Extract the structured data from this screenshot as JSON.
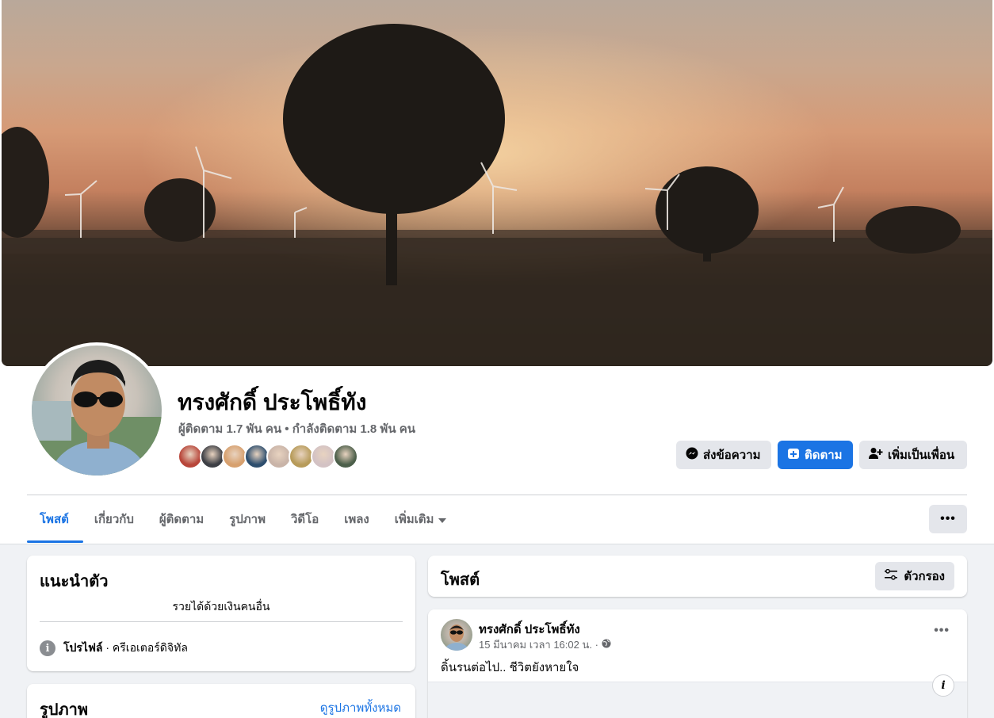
{
  "profile": {
    "name": "ทรงศักดิ์ ประโพธิ์ทัง",
    "follow_stats": "ผู้ติดตาม 1.7 พัน คน • กำลังติดตาม 1.8 พัน คน",
    "mutual_avatar_colors": [
      "#b8463a",
      "#3d3f45",
      "#d7a06e",
      "#2d4e6e",
      "#c9b4a8",
      "#b79b5a",
      "#d3c2c4",
      "#4c5f4a"
    ]
  },
  "actions": {
    "message": "ส่งข้อความ",
    "follow": "ติดตาม",
    "add_friend": "เพิ่มเป็นเพื่อน"
  },
  "tabs": [
    {
      "label": "โพสต์"
    },
    {
      "label": "เกี่ยวกับ"
    },
    {
      "label": "ผู้ติดตาม"
    },
    {
      "label": "รูปภาพ"
    },
    {
      "label": "วิดีโอ"
    },
    {
      "label": "เพลง"
    },
    {
      "label": "เพิ่มเติม"
    }
  ],
  "more_button": "•••",
  "intro": {
    "title": "แนะนำตัว",
    "bio": "รวยได้ด้วยเงินคนอื่น",
    "profile_label": "โปรไฟล์",
    "profile_value": " · ครีเอเตอร์ดิจิทัล"
  },
  "photos": {
    "title": "รูปภาพ",
    "see_all": "ดูรูปภาพทั้งหมด"
  },
  "posts": {
    "title": "โพสต์",
    "filter": "ตัวกรอง"
  },
  "post": {
    "author": "ทรงศักดิ์ ประโพธิ์ทัง",
    "timestamp": "15 มีนาคม เวลา 16:02 น. ·",
    "text": "ดิ้นรนต่อไป.. ชีวิตยังหายใจ",
    "menu": "•••"
  },
  "colors": {
    "accent": "#1b74e4",
    "secondary_text": "#65676b",
    "button_gray": "#e4e6eb",
    "feed_background": "#f0f2f5"
  }
}
